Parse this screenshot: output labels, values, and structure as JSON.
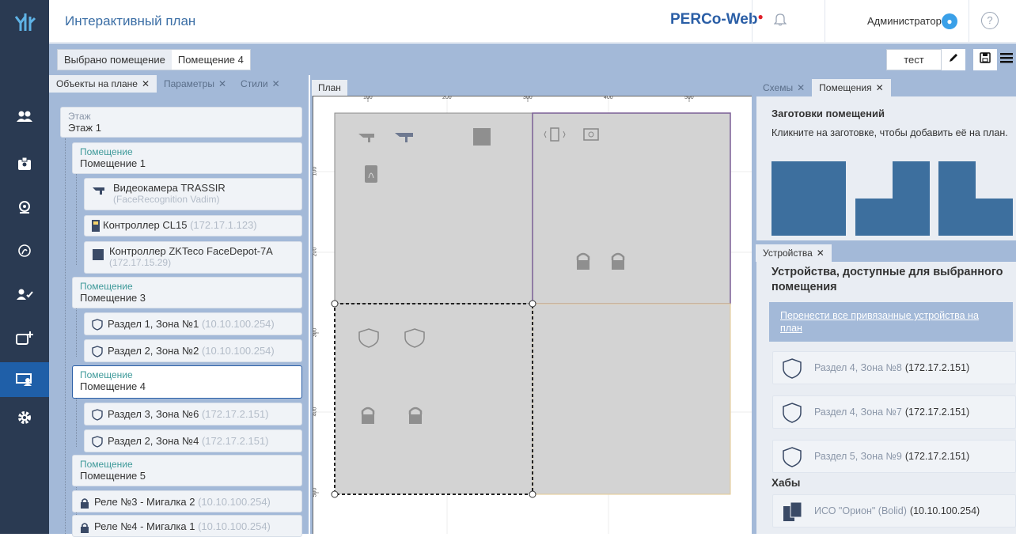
{
  "header": {
    "title": "Интерактивный план",
    "brand": "PERCo-Web",
    "user": "Администратор",
    "help": "?"
  },
  "toolbar": {
    "selected_label": "Выбрано помещение",
    "selected_value": "Помещение 4",
    "name_value": "тест"
  },
  "left_tabs": [
    {
      "label": "Объекты на плане"
    },
    {
      "label": "Параметры"
    },
    {
      "label": "Стили"
    }
  ],
  "tree": {
    "floor_type": "Этаж",
    "floor_name": "Этаж 1",
    "room_type": "Помещение",
    "rooms": [
      {
        "name": "Помещение 1"
      },
      {
        "name": "Помещение 3"
      },
      {
        "name": "Помещение 4"
      },
      {
        "name": "Помещение 5"
      }
    ],
    "devices": [
      {
        "name": "Видеокамера TRASSIR",
        "sub": "(FaceRecognition Vadim)"
      },
      {
        "name": "Контроллер CL15",
        "sub": "(172.17.1.123)"
      },
      {
        "name": "Контроллер ZKTeco FaceDepot-7A",
        "sub": "(172.17.15.29)"
      },
      {
        "name": "Раздел 1, Зона №1",
        "sub": "(10.10.100.254)"
      },
      {
        "name": "Раздел 2, Зона №2",
        "sub": "(10.10.100.254)"
      },
      {
        "name": "Раздел 3, Зона №6",
        "sub": "(172.17.2.151)"
      },
      {
        "name": "Раздел 2, Зона №4",
        "sub": "(172.17.2.151)"
      },
      {
        "name": "Реле №3 - Мигалка 2",
        "sub": "(10.10.100.254)"
      },
      {
        "name": "Реле №4 - Мигалка 1",
        "sub": "(10.10.100.254)"
      }
    ]
  },
  "plan": {
    "tab": "План",
    "ruler_x": [
      "100",
      "200",
      "300",
      "400",
      "500"
    ],
    "ruler_y": [
      "100",
      "200",
      "300",
      "400",
      "500"
    ]
  },
  "right_tabs": [
    {
      "label": "Схемы"
    },
    {
      "label": "Помещения"
    }
  ],
  "templates": {
    "title": "Заготовки помещений",
    "hint": "Кликните на заготовке, чтобы добавить её на план."
  },
  "devices_panel": {
    "tab": "Устройства",
    "title": "Устройства, доступные для выбранного помещения",
    "link": "Перенести все привязанные устройства на план",
    "items": [
      {
        "name": "Раздел 4, Зона №8",
        "ip": "(172.17.2.151)"
      },
      {
        "name": "Раздел 4, Зона №7",
        "ip": "(172.17.2.151)"
      },
      {
        "name": "Раздел 5, Зона №9",
        "ip": "(172.17.2.151)"
      }
    ],
    "hubs_title": "Хабы",
    "hub": {
      "name": "ИСО \"Орион\" (Bolid)",
      "ip": "(10.10.100.254)"
    }
  },
  "colors": {
    "sidebar": "#2a3a52",
    "accent": "#1f5fa8",
    "panel": "#a3b9d8",
    "room": "#d3d3d3"
  }
}
